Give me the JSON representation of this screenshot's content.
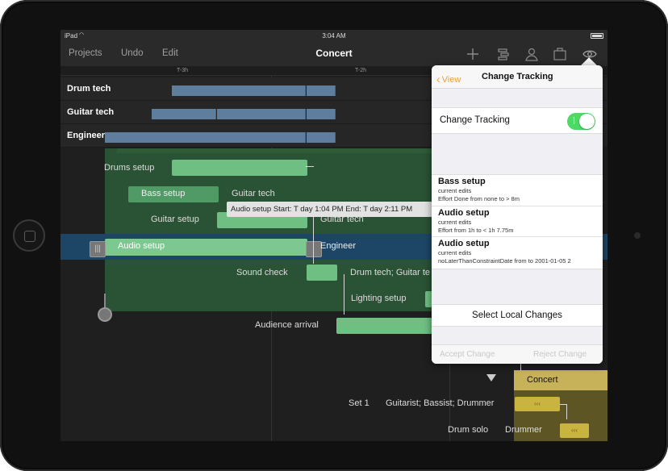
{
  "status_bar": {
    "carrier": "iPad",
    "time": "3:04 AM"
  },
  "navbar": {
    "projects": "Projects",
    "undo": "Undo",
    "edit": "Edit",
    "title": "Concert",
    "icons": [
      "plus-icon",
      "outline-icon",
      "person-icon",
      "briefcase-icon",
      "eye-icon"
    ]
  },
  "ruler": {
    "ticks": [
      "T-3h",
      "T-2h"
    ]
  },
  "resources": [
    {
      "name": "Drum tech"
    },
    {
      "name": "Guitar tech"
    },
    {
      "name": "Engineer"
    }
  ],
  "tasks": {
    "drums_setup": {
      "name": "Drums setup"
    },
    "bass_setup": {
      "name": "Bass setup",
      "resource": "Guitar tech"
    },
    "guitar_setup": {
      "name": "Guitar setup",
      "resource": "Guitar tech"
    },
    "audio_setup": {
      "name": "Audio setup",
      "resource": "Engineer"
    },
    "sound_check": {
      "name": "Sound check",
      "resource": "Drum tech; Guitar te"
    },
    "lighting_setup": {
      "name": "Lighting setup"
    },
    "audience_arrival": {
      "name": "Audience arrival"
    },
    "concert": {
      "name": "Concert"
    },
    "set_1": {
      "name": "Set 1",
      "resource": "Guitarist; Bassist; Drummer"
    },
    "drum_solo": {
      "name": "Drum solo",
      "resource": "Drummer"
    }
  },
  "milestone_marks": {
    "collapsed": "‹‹‹"
  },
  "tooltip": {
    "text": "Audio setup   Start: T day 1:04 PM   End: T day 2:11 PM"
  },
  "popover": {
    "back_label": "View",
    "title": "Change Tracking",
    "toggle_label": "Change Tracking",
    "toggle_on": true,
    "changes": [
      {
        "name": "Bass setup",
        "status": "current edits",
        "detail": "Effort Done from none to > 8m"
      },
      {
        "name": "Audio setup",
        "status": "current edits",
        "detail": "Effort from 1h to < 1h 7.75m"
      },
      {
        "name": "Audio setup",
        "status": "current edits",
        "detail": "noLaterThanConstraintDate from  to 2001-01-05 2"
      }
    ],
    "select_local": "Select Local Changes",
    "accept": "Accept Change",
    "reject": "Reject Change"
  },
  "colors": {
    "accent": "#e9a23b",
    "task_bar": "#6fbf83",
    "resource_bar": "#5f7d9c",
    "selection": "#1d4666",
    "toggle_on": "#4cd964",
    "milestone": "#c9b441"
  }
}
